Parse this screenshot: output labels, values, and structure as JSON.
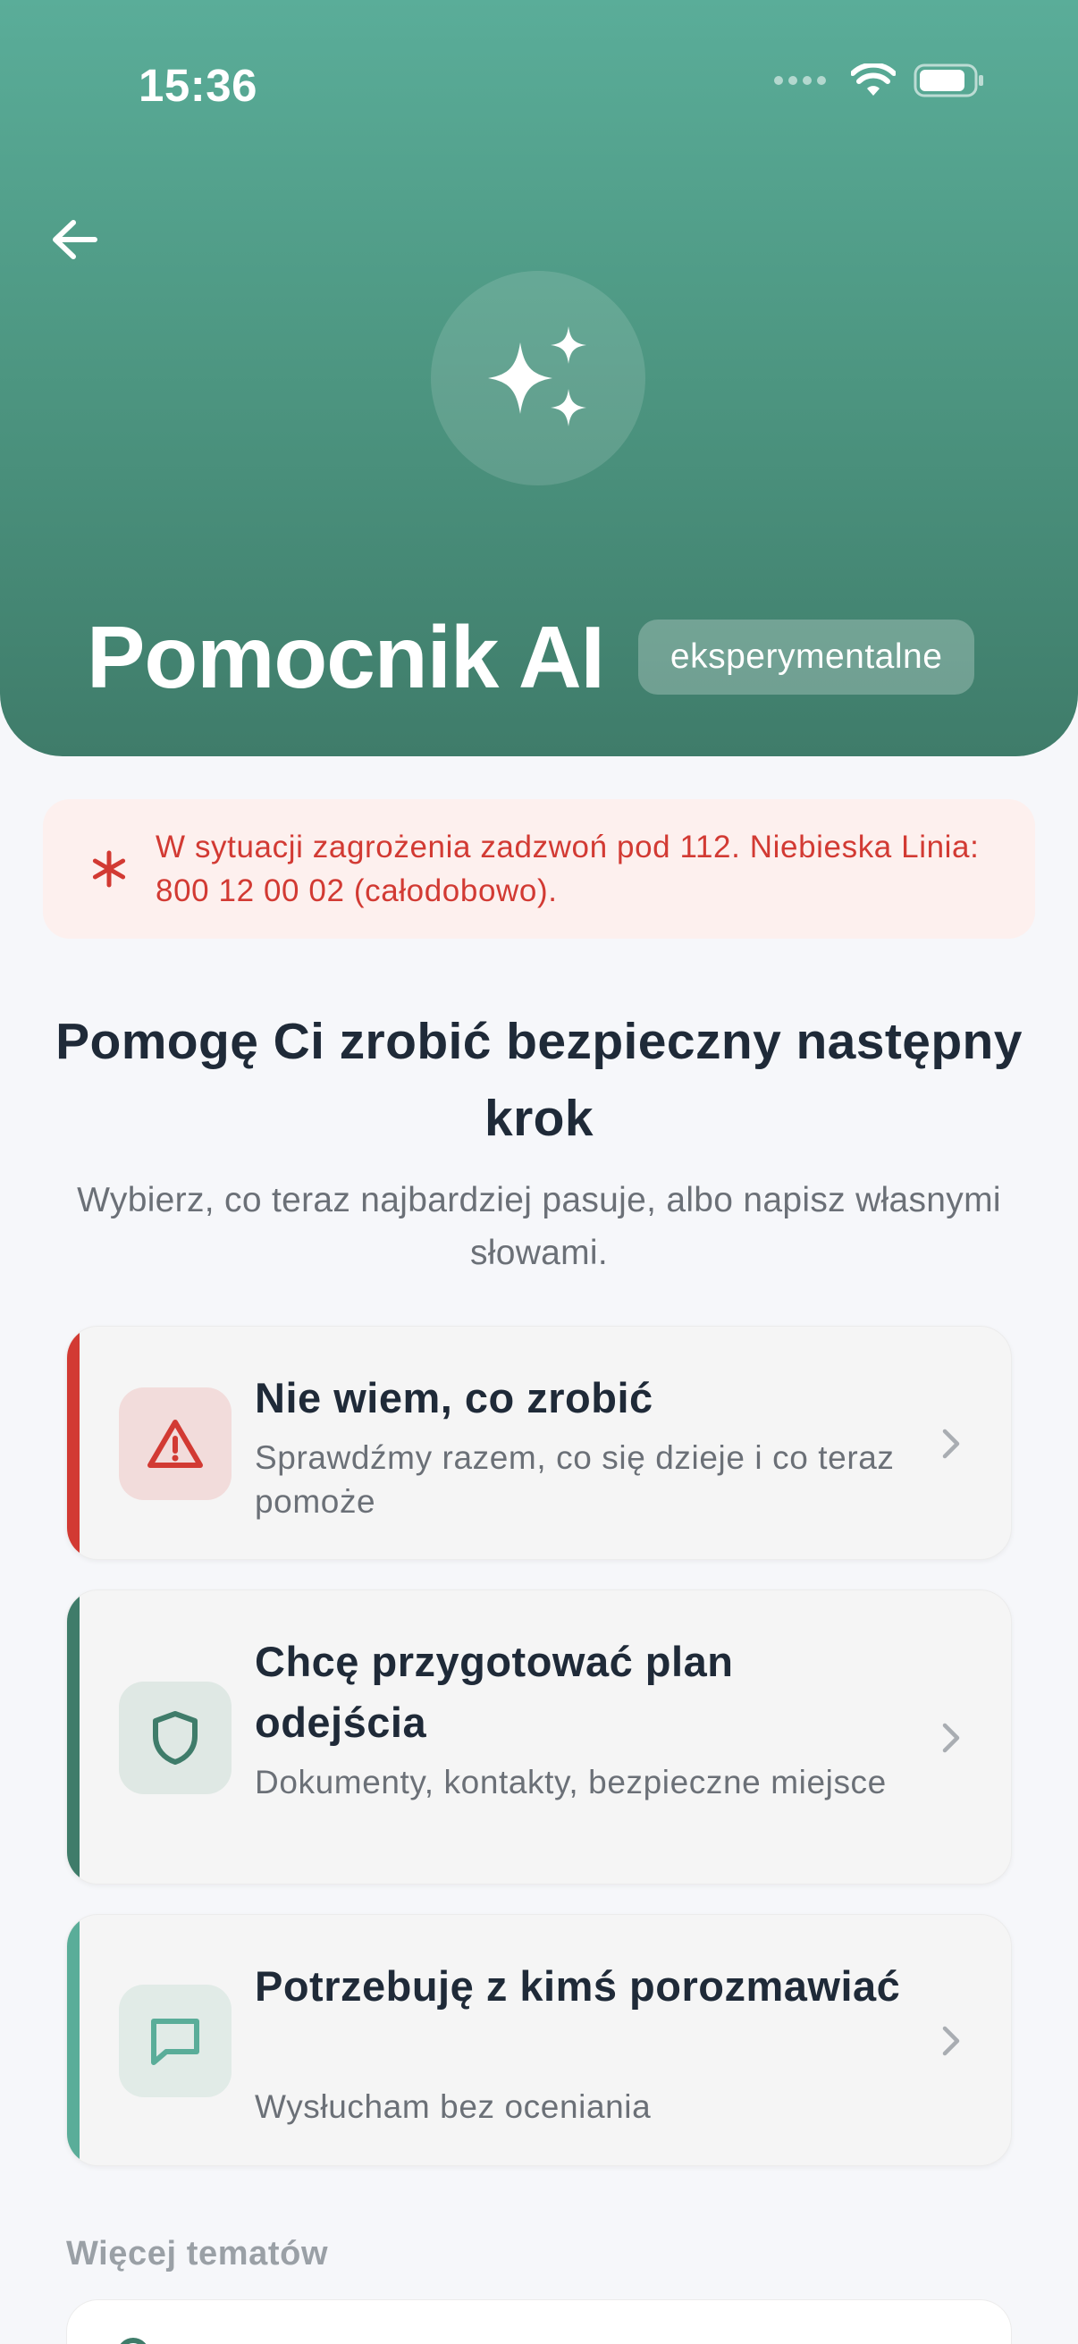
{
  "status_bar": {
    "time": "15:36"
  },
  "header": {
    "title": "Pomocnik AI",
    "badge": "eksperymentalne"
  },
  "alert": {
    "text": "W sytuacji zagrożenia zadzwoń pod 112. Niebieska Linia: 800 12 00 02 (całodobowo)."
  },
  "intro": {
    "title": "Pomogę Ci zrobić bezpieczny następny krok",
    "subtitle": "Wybierz, co teraz najbardziej pasuje, albo napisz własnymi słowami."
  },
  "options": [
    {
      "title": "Nie wiem, co zrobić",
      "subtitle": "Sprawdźmy razem, co się dzieje i co teraz pomoże",
      "icon": "warning-icon",
      "accent": "#d23a33"
    },
    {
      "title": "Chcę przygotować plan odejścia",
      "subtitle": "Dokumenty, kontakty, bezpieczne miejsce",
      "icon": "shield-icon",
      "accent": "#3f7c6a"
    },
    {
      "title": "Potrzebuję z kimś porozmawiać",
      "subtitle": "Wysłucham bez oceniania",
      "icon": "chat-icon",
      "accent": "#5aad99"
    }
  ],
  "more_topics": {
    "label": "Więcej tematów"
  },
  "colors": {
    "brand": "#4e9883",
    "danger": "#d23a33",
    "text": "#1f2a38"
  }
}
